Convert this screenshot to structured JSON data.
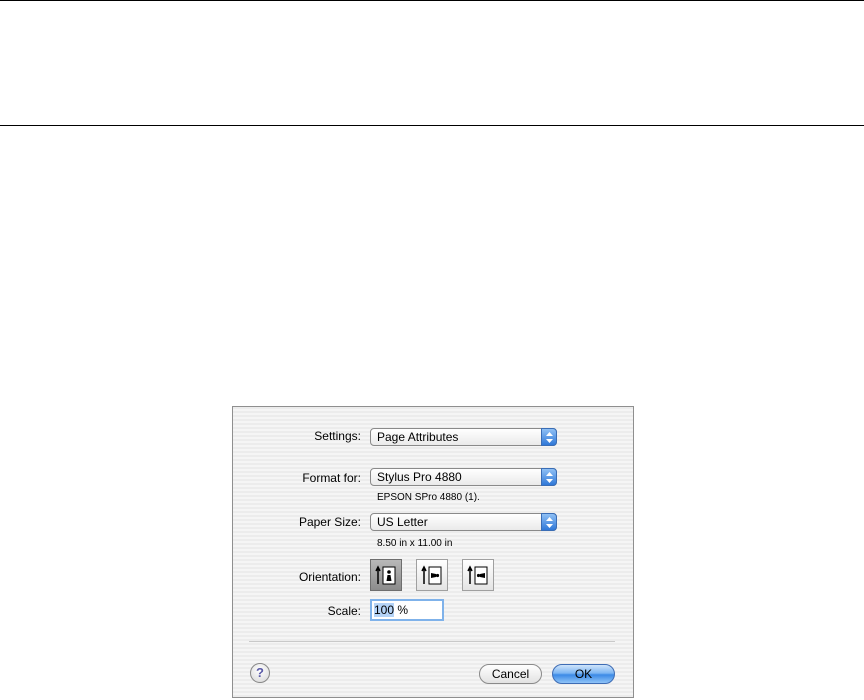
{
  "dialog": {
    "settings": {
      "label": "Settings:",
      "value": "Page Attributes"
    },
    "format_for": {
      "label": "Format for:",
      "value": "Stylus Pro 4880",
      "detail": "EPSON SPro 4880 (1)."
    },
    "paper_size": {
      "label": "Paper Size:",
      "value": "US Letter",
      "detail": "8.50 in x 11.00 in"
    },
    "orientation": {
      "label": "Orientation:",
      "options": [
        "portrait",
        "landscape-left",
        "landscape-right"
      ],
      "selected": "portrait"
    },
    "scale": {
      "label": "Scale:",
      "value": "100",
      "unit": " %"
    },
    "help": {
      "glyph": "?"
    },
    "buttons": {
      "cancel": "Cancel",
      "ok": "OK"
    }
  },
  "colors": {
    "accent": "#3c8ae6",
    "selection": "#b4d3f7"
  }
}
